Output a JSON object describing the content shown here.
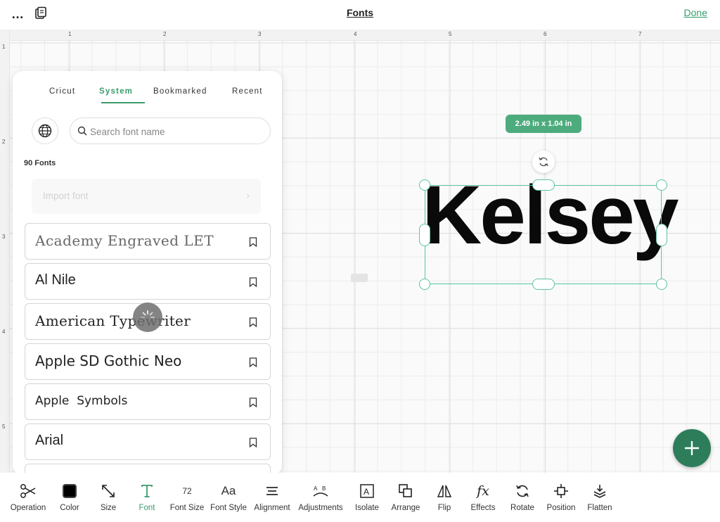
{
  "header": {
    "more_icon": "…",
    "title": "Fonts",
    "done_label": "Done"
  },
  "ruler": {
    "top_ticks": [
      "1",
      "2",
      "3",
      "4",
      "5",
      "6",
      "7"
    ],
    "left_ticks": [
      "1",
      "2",
      "3",
      "4",
      "5"
    ]
  },
  "font_panel": {
    "tabs": [
      {
        "label": "Cricut",
        "active": false
      },
      {
        "label": "System",
        "active": true
      },
      {
        "label": "Bookmarked",
        "active": false
      },
      {
        "label": "Recent",
        "active": false
      }
    ],
    "search_placeholder": "Search font name",
    "count_label": "90 Fonts",
    "import_label": "Import font",
    "import_chevron": "›",
    "fonts": [
      {
        "name": "Academy Engraved LET"
      },
      {
        "name": "Al Nile"
      },
      {
        "name": "American Typewriter"
      },
      {
        "name": "Apple SD Gothic Neo"
      },
      {
        "name": "Apple  Symbols"
      },
      {
        "name": "Arial"
      }
    ]
  },
  "canvas": {
    "text": "Kelsey",
    "dimensions_label": "2.49 in x 1.04 in"
  },
  "toolbar": {
    "items": [
      {
        "label": "Operation",
        "icon": "scissors-icon"
      },
      {
        "label": "Color",
        "icon": "color-swatch-icon"
      },
      {
        "label": "Size",
        "icon": "resize-icon"
      },
      {
        "label": "Font",
        "icon": "font-icon",
        "active": true
      },
      {
        "label": "Font Size",
        "icon": "font-size-icon",
        "value": "72"
      },
      {
        "label": "Font Style",
        "icon": "font-style-icon",
        "glyph": "Aa"
      },
      {
        "label": "Alignment",
        "icon": "alignment-icon"
      },
      {
        "label": "Adjustments",
        "icon": "adjustments-icon"
      },
      {
        "label": "Isolate",
        "icon": "isolate-icon"
      },
      {
        "label": "Arrange",
        "icon": "arrange-icon"
      },
      {
        "label": "Flip",
        "icon": "flip-icon"
      },
      {
        "label": "Effects",
        "icon": "effects-icon",
        "glyph": "fx"
      },
      {
        "label": "Rotate",
        "icon": "rotate-icon"
      },
      {
        "label": "Position",
        "icon": "position-icon"
      },
      {
        "label": "Flatten",
        "icon": "flatten-icon"
      }
    ]
  },
  "colors": {
    "accent": "#3b9b6e",
    "selection": "#5cc4a0",
    "fab": "#2e7d5a"
  }
}
